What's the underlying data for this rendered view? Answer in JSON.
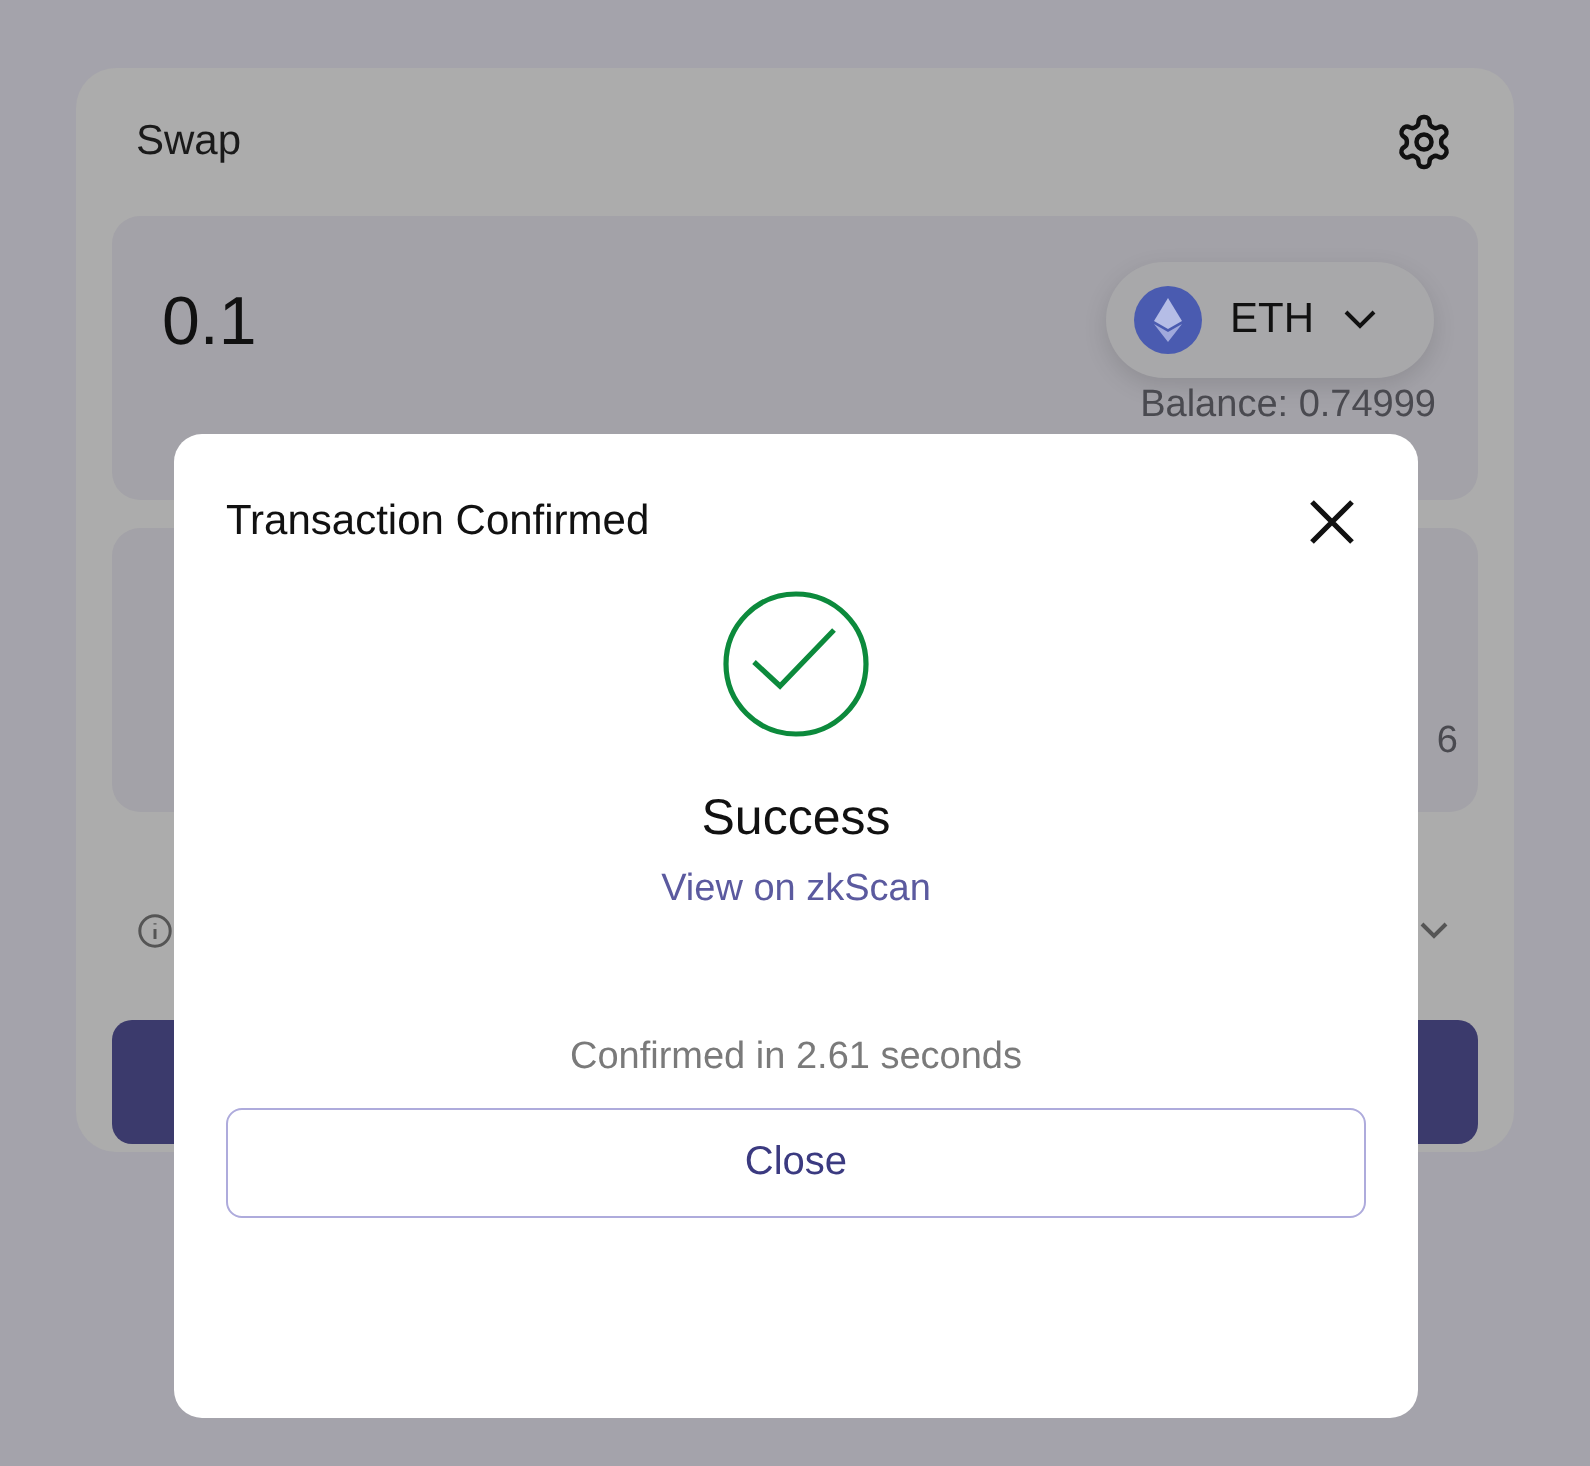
{
  "swap": {
    "title": "Swap",
    "from": {
      "amount": "0.1",
      "token": "ETH",
      "balance": "Balance: 0.74999"
    },
    "to": {
      "balance_fragment": "6"
    }
  },
  "modal": {
    "title": "Transaction Confirmed",
    "status": "Success",
    "link": "View on zkScan",
    "note": "Confirmed in 2.61 seconds",
    "button": "Close"
  }
}
